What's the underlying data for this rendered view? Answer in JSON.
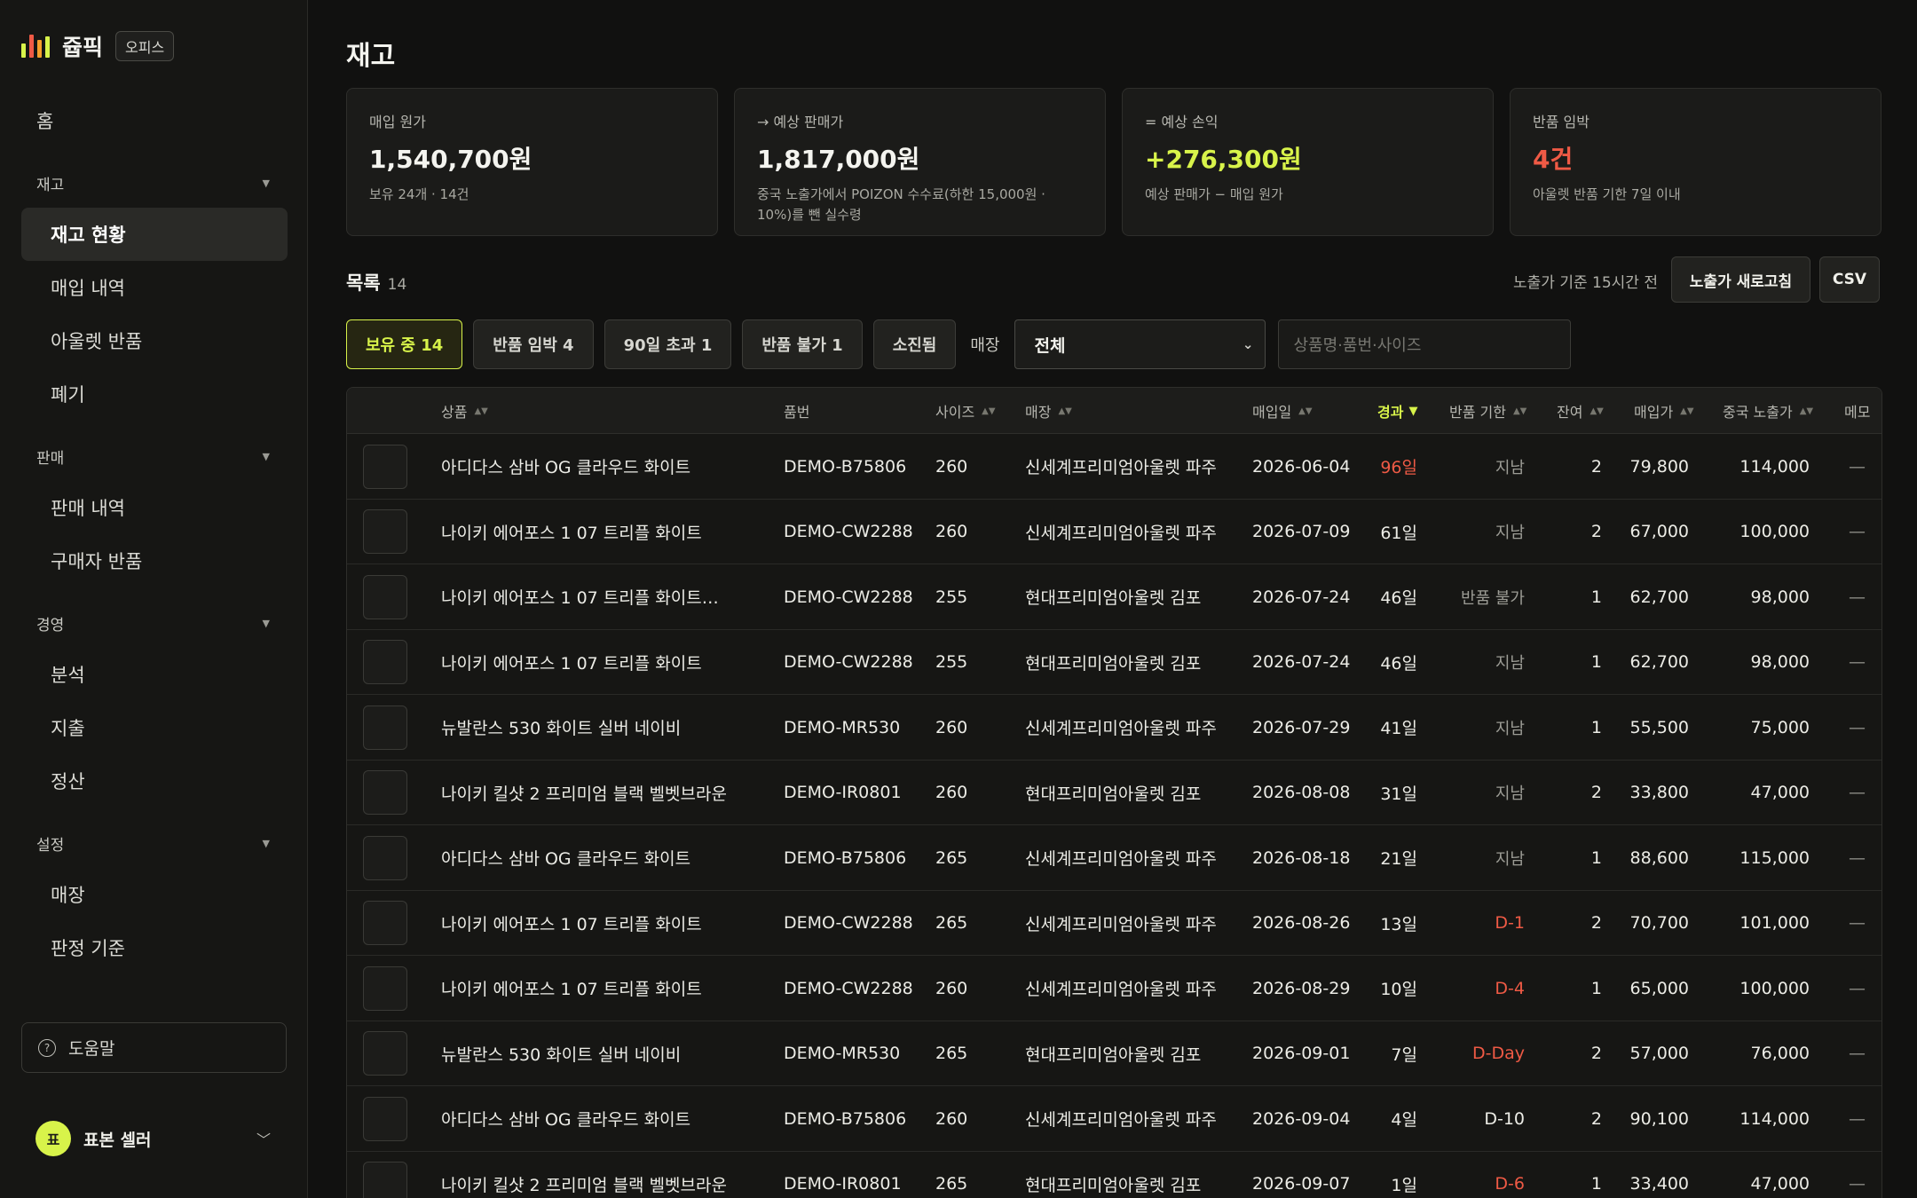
{
  "brand": {
    "name": "쥽픽",
    "badge": "오피스",
    "logo_colors": [
      "#d8f34a",
      "#ef5a45",
      "#f59f2a",
      "#d8f34a"
    ]
  },
  "sidebar": {
    "home": "홈",
    "groups": [
      {
        "label": "재고",
        "items": [
          "재고 현황",
          "매입 내역",
          "아울렛 반품",
          "폐기"
        ]
      },
      {
        "label": "판매",
        "items": [
          "판매 내역",
          "구매자 반품"
        ]
      },
      {
        "label": "경영",
        "items": [
          "분석",
          "지출",
          "정산"
        ]
      },
      {
        "label": "설정",
        "items": [
          "매장",
          "판정 기준"
        ]
      }
    ],
    "active_item": "재고 현황",
    "help": "도움말",
    "user": {
      "initial": "표",
      "name": "표본 셀러"
    }
  },
  "page": {
    "title": "재고"
  },
  "cards": [
    {
      "label": "매입 원가",
      "value": "1,540,700원",
      "sub": "보유 24개 · 14건",
      "tone": "normal"
    },
    {
      "label": "→ 예상 판매가",
      "value": "1,817,000원",
      "sub": "중국 노출가에서 POIZON 수수료(하한 15,000원 · 10%)를 뺀 실수령",
      "tone": "normal"
    },
    {
      "label": "= 예상 손익",
      "value": "+276,300원",
      "sub": "예상 판매가 − 매입 원가",
      "tone": "pos"
    },
    {
      "label": "반품 임박",
      "value": "4건",
      "sub": "아울렛 반품 기한 7일 이내",
      "tone": "neg"
    }
  ],
  "list": {
    "title": "목록",
    "count": "14",
    "refresh_note": "노출가 기준 15시간 전",
    "refresh_button": "노출가 새로고침",
    "csv_button": "CSV"
  },
  "filters": {
    "chips": [
      "보유 중 14",
      "반품 임박 4",
      "90일 초과 1",
      "반품 불가 1",
      "소진됨"
    ],
    "active_chip": "보유 중 14",
    "store_label": "매장",
    "store_value": "전체",
    "search_placeholder": "상품명·품번·사이즈"
  },
  "table": {
    "columns": [
      "상품",
      "품번",
      "사이즈",
      "매장",
      "매입일",
      "경과",
      "반품 기한",
      "잔여",
      "매입가",
      "중국 노출가",
      "메모"
    ],
    "sorted_column": "경과",
    "rows": [
      {
        "product": "아디다스 삼바 OG 클라우드 화이트",
        "sku": "DEMO-B75806",
        "size": "260",
        "store": "신세계프리미엄아울렛 파주",
        "date": "2026-06-04",
        "elapsed": "96일",
        "elapsed_red": true,
        "deadline": "지남",
        "deadline_tone": "muted",
        "remain": "2",
        "cost": "79,800",
        "cn_price": "114,000",
        "memo": "—"
      },
      {
        "product": "나이키 에어포스 1 07 트리플 화이트",
        "sku": "DEMO-CW2288",
        "size": "260",
        "store": "신세계프리미엄아울렛 파주",
        "date": "2026-07-09",
        "elapsed": "61일",
        "elapsed_red": false,
        "deadline": "지남",
        "deadline_tone": "muted",
        "remain": "2",
        "cost": "67,000",
        "cn_price": "100,000",
        "memo": "—"
      },
      {
        "product": "나이키 에어포스 1 07 트리플 화이트…",
        "sku": "DEMO-CW2288",
        "size": "255",
        "store": "현대프리미엄아울렛 김포",
        "date": "2026-07-24",
        "elapsed": "46일",
        "elapsed_red": false,
        "deadline": "반품 불가",
        "deadline_tone": "muted",
        "remain": "1",
        "cost": "62,700",
        "cn_price": "98,000",
        "memo": "—"
      },
      {
        "product": "나이키 에어포스 1 07 트리플 화이트",
        "sku": "DEMO-CW2288",
        "size": "255",
        "store": "현대프리미엄아울렛 김포",
        "date": "2026-07-24",
        "elapsed": "46일",
        "elapsed_red": false,
        "deadline": "지남",
        "deadline_tone": "muted",
        "remain": "1",
        "cost": "62,700",
        "cn_price": "98,000",
        "memo": "—"
      },
      {
        "product": "뉴발란스 530 화이트 실버 네이비",
        "sku": "DEMO-MR530",
        "size": "260",
        "store": "신세계프리미엄아울렛 파주",
        "date": "2026-07-29",
        "elapsed": "41일",
        "elapsed_red": false,
        "deadline": "지남",
        "deadline_tone": "muted",
        "remain": "1",
        "cost": "55,500",
        "cn_price": "75,000",
        "memo": "—"
      },
      {
        "product": "나이키 킬샷 2 프리미엄 블랙 벨벳브라운",
        "sku": "DEMO-IR0801",
        "size": "260",
        "store": "현대프리미엄아울렛 김포",
        "date": "2026-08-08",
        "elapsed": "31일",
        "elapsed_red": false,
        "deadline": "지남",
        "deadline_tone": "muted",
        "remain": "2",
        "cost": "33,800",
        "cn_price": "47,000",
        "memo": "—"
      },
      {
        "product": "아디다스 삼바 OG 클라우드 화이트",
        "sku": "DEMO-B75806",
        "size": "265",
        "store": "신세계프리미엄아울렛 파주",
        "date": "2026-08-18",
        "elapsed": "21일",
        "elapsed_red": false,
        "deadline": "지남",
        "deadline_tone": "muted",
        "remain": "1",
        "cost": "88,600",
        "cn_price": "115,000",
        "memo": "—"
      },
      {
        "product": "나이키 에어포스 1 07 트리플 화이트",
        "sku": "DEMO-CW2288",
        "size": "265",
        "store": "신세계프리미엄아울렛 파주",
        "date": "2026-08-26",
        "elapsed": "13일",
        "elapsed_red": false,
        "deadline": "D-1",
        "deadline_tone": "red",
        "remain": "2",
        "cost": "70,700",
        "cn_price": "101,000",
        "memo": "—"
      },
      {
        "product": "나이키 에어포스 1 07 트리플 화이트",
        "sku": "DEMO-CW2288",
        "size": "260",
        "store": "신세계프리미엄아울렛 파주",
        "date": "2026-08-29",
        "elapsed": "10일",
        "elapsed_red": false,
        "deadline": "D-4",
        "deadline_tone": "red",
        "remain": "1",
        "cost": "65,000",
        "cn_price": "100,000",
        "memo": "—"
      },
      {
        "product": "뉴발란스 530 화이트 실버 네이비",
        "sku": "DEMO-MR530",
        "size": "265",
        "store": "현대프리미엄아울렛 김포",
        "date": "2026-09-01",
        "elapsed": "7일",
        "elapsed_red": false,
        "deadline": "D-Day",
        "deadline_tone": "red",
        "remain": "2",
        "cost": "57,000",
        "cn_price": "76,000",
        "memo": "—"
      },
      {
        "product": "아디다스 삼바 OG 클라우드 화이트",
        "sku": "DEMO-B75806",
        "size": "260",
        "store": "신세계프리미엄아울렛 파주",
        "date": "2026-09-04",
        "elapsed": "4일",
        "elapsed_red": false,
        "deadline": "D-10",
        "deadline_tone": "normal",
        "remain": "2",
        "cost": "90,100",
        "cn_price": "114,000",
        "memo": "—"
      },
      {
        "product": "나이키 킬샷 2 프리미엄 블랙 벨벳브라운",
        "sku": "DEMO-IR0801",
        "size": "265",
        "store": "현대프리미엄아울렛 김포",
        "date": "2026-09-07",
        "elapsed": "1일",
        "elapsed_red": false,
        "deadline": "D-6",
        "deadline_tone": "red",
        "remain": "1",
        "cost": "33,400",
        "cn_price": "47,000",
        "memo": "—"
      }
    ]
  },
  "icons": {
    "help": "help-circle-icon",
    "sort": "sort-arrows-icon",
    "caret": "chevron-down-icon"
  }
}
